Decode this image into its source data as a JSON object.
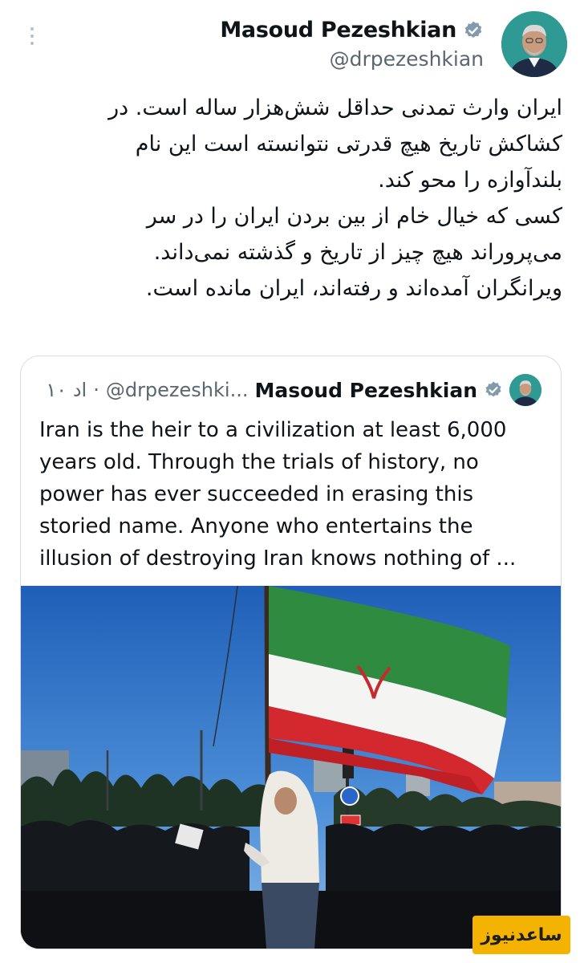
{
  "colors": {
    "verified_badge": "#829aab",
    "handle_gray": "#5b6670",
    "border": "#d9dee2",
    "watermark_bg": "#f3b300"
  },
  "icons": {
    "more": "more-vertical-icon",
    "verified": "verified-badge-icon"
  },
  "author": {
    "name": "Masoud Pezeshkian",
    "handle": "@drpezeshkian"
  },
  "tweet": {
    "text": "ایران وارث تمدنی حداقل شش‌هزار ساله است. در\nکشاکش تاریخ هیچ قدرتی نتوانسته است این نام\nبلندآوازه را محو کند.\nکسی که خیال خام از بین بردن ایران را در سر\nمی‌پروراند هیچ چیز از تاریخ و گذشته نمی‌داند.\nویرانگران آمده‌اند و رفته‌اند، ایران مانده است."
  },
  "quoted": {
    "name": "Masoud Pezeshkian",
    "handle": "@drpezeshki...",
    "time": "۱۰ اد",
    "text": "Iran is the heir to a civilization at least 6,000\nyears old. Through the trials of history, no\npower has ever succeeded in erasing this\nstoried name. Anyone who entertains the\nillusion of destroying Iran knows nothing of ..."
  },
  "watermark": {
    "text": "ساعدنیوز"
  }
}
